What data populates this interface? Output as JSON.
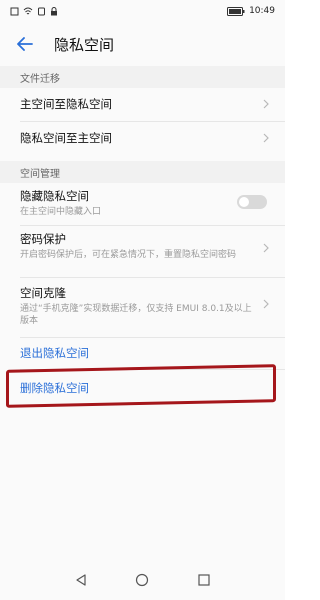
{
  "status_bar": {
    "time": "10:49"
  },
  "app_bar": {
    "title": "隐私空间"
  },
  "sections": {
    "file_migration": "文件迁移",
    "space_management": "空间管理"
  },
  "rows": {
    "main_to_private": "主空间至隐私空间",
    "private_to_main": "隐私空间至主空间",
    "hide_private": {
      "title": "隐藏隐私空间",
      "sub": "在主空间中隐藏入口"
    },
    "password_protect": {
      "title": "密码保护",
      "sub": "开启密码保护后，可在紧急情况下，重置隐私空间密码"
    },
    "space_clone": {
      "title": "空间克隆",
      "sub": "通过“手机克隆”实现数据迁移，仅支持 EMUI 8.0.1及以上版本"
    }
  },
  "links": {
    "exit_private": "退出隐私空间",
    "delete_private": "删除隐私空间"
  },
  "toggle_state": {
    "hide_private_on": false
  },
  "colors": {
    "accent": "#2a6fd8",
    "highlight_box": "#a5161b"
  },
  "icons": {
    "back": "arrow-left-icon",
    "nav_back": "triangle-back-icon",
    "nav_home": "circle-home-icon",
    "nav_recent": "square-recent-icon"
  }
}
